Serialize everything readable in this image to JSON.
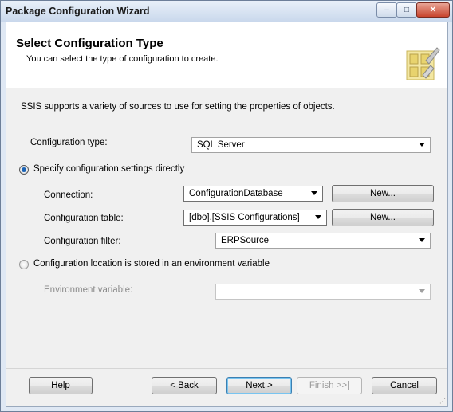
{
  "window": {
    "title": "Package Configuration Wizard"
  },
  "title_buttons": {
    "minimize": "–",
    "maximize": "□",
    "close": "✕"
  },
  "header": {
    "title": "Select Configuration Type",
    "subtitle": "You can select the type of configuration to create."
  },
  "description": "SSIS supports a variety of sources to use for setting the properties of objects.",
  "config_type": {
    "label": "Configuration type:",
    "value": "SQL Server"
  },
  "option_direct": {
    "label": "Specify configuration settings directly",
    "selected": true
  },
  "connection": {
    "label": "Connection:",
    "value": "ConfigurationDatabase",
    "new_button": "New..."
  },
  "config_table": {
    "label": "Configuration table:",
    "value": "[dbo].[SSIS Configurations]",
    "new_button": "New..."
  },
  "config_filter": {
    "label": "Configuration filter:",
    "value": "ERPSource"
  },
  "option_env": {
    "label": "Configuration location is stored in an environment variable",
    "selected": false
  },
  "env_variable": {
    "label": "Environment variable:",
    "value": ""
  },
  "buttons": {
    "help": "Help",
    "back": "< Back",
    "next": "Next >",
    "finish": "Finish >>|",
    "cancel": "Cancel"
  },
  "colors": {
    "accent": "#1a63b6",
    "title_close": "#c8432c"
  }
}
